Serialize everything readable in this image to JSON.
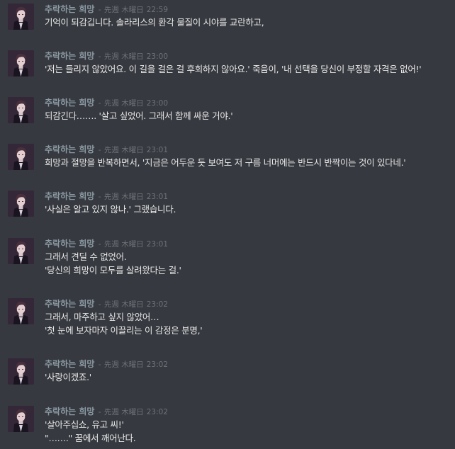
{
  "channel": {
    "messages": [
      {
        "author": "추락하는 희망",
        "separator": "-",
        "date": "先週 木曜日",
        "time": "22:59",
        "lines": [
          "기억이 되감깁니다. 솔라리스의 환각 물질이 시야를  교란하고,"
        ]
      },
      {
        "author": "추락하는 희망",
        "separator": "-",
        "date": "先週 木曜日",
        "time": "23:00",
        "lines": [
          "'저는 들리지 않았어요. 이 길을 걸은 걸 후회하지 않아요.' 죽음이, '내 선택을 당신이 부정할 자격은 없어!'"
        ]
      },
      {
        "author": "추락하는 희망",
        "separator": "-",
        "date": "先週 木曜日",
        "time": "23:00",
        "lines": [
          "되감긴다……. '살고 싶었어. 그래서 함께 싸운 거야.'"
        ]
      },
      {
        "author": "추락하는 희망",
        "separator": "-",
        "date": "先週 木曜日",
        "time": "23:01",
        "lines": [
          "희망과 절망을 반복하면서, '지금은 어두운 듯 보여도 저 구름 너머에는 반드시 반짝이는 것이 있다네.'"
        ]
      },
      {
        "author": "추락하는 희망",
        "separator": "-",
        "date": "先週 木曜日",
        "time": "23:01",
        "lines": [
          "'사실은 알고 있지 않나.' 그랬습니다."
        ]
      },
      {
        "author": "추락하는 희망",
        "separator": "-",
        "date": "先週 木曜日",
        "time": "23:01",
        "lines": [
          "그래서 견딜 수 없었어.",
          "'당신의 희망이 모두를 살려왔다는 걸.'"
        ]
      },
      {
        "author": "추락하는 희망",
        "separator": "-",
        "date": "先週 木曜日",
        "time": "23:02",
        "lines": [
          "그래서, 마주하고 싶지 않았어…",
          "'첫 눈에 보자마자 이끌리는 이 감정은 분명,'"
        ]
      },
      {
        "author": "추락하는 희망",
        "separator": "-",
        "date": "先週 木曜日",
        "time": "23:02",
        "lines": [
          "'사랑이겠죠.'"
        ]
      },
      {
        "author": "추락하는 희망",
        "separator": "-",
        "date": "先週 木曜日",
        "time": "23:02",
        "lines": [
          "'살아주십쇼, 유고 씨!'",
          "\"…….\" 꿈에서 깨어난다."
        ]
      }
    ]
  },
  "avatar_icon": "anime-character-dark-suit-icon",
  "colors": {
    "background": "#36393f",
    "author": "#8c9aa3",
    "timestamp": "#6f7378",
    "text": "#e8e8e8"
  }
}
